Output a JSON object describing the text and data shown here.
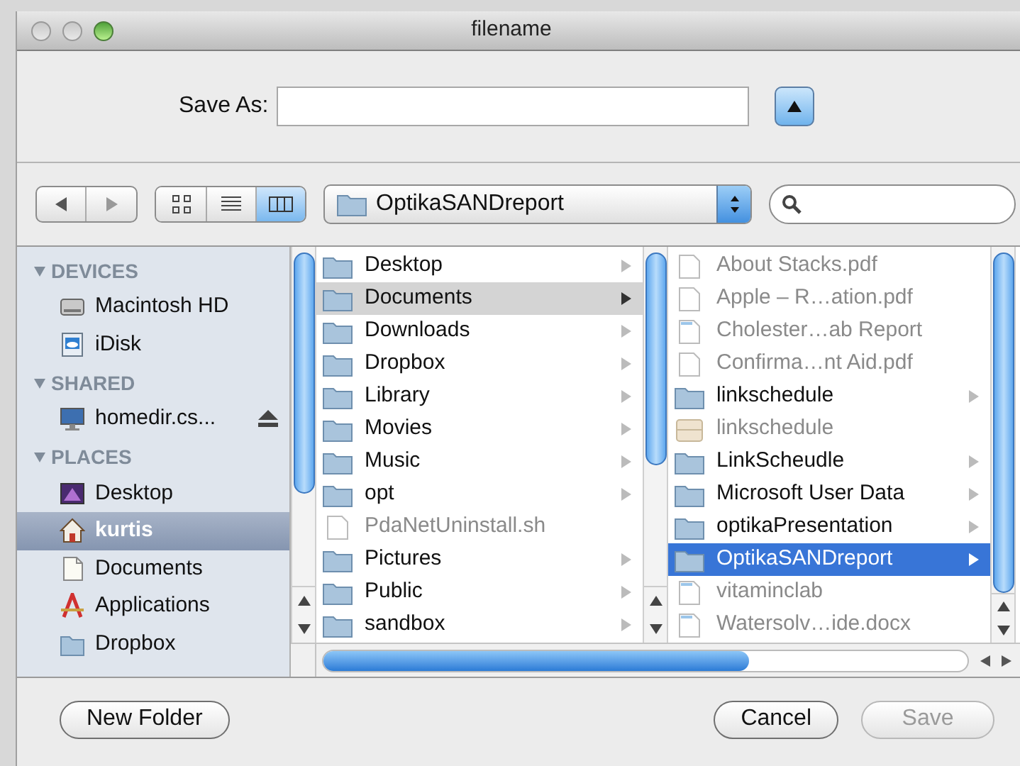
{
  "window": {
    "title": "filename"
  },
  "save_as": {
    "label": "Save As:",
    "expanded": true
  },
  "toolbar": {
    "views": [
      {
        "kind": "icons",
        "selected": false
      },
      {
        "kind": "list",
        "selected": false
      },
      {
        "kind": "columns",
        "selected": true
      }
    ],
    "location": "OptikaSANDreport"
  },
  "sidebar": {
    "sections": [
      {
        "title": "DEVICES",
        "items": [
          {
            "label": "Macintosh HD",
            "kind": "disk",
            "selected": false
          },
          {
            "label": "iDisk",
            "kind": "idisk",
            "selected": false
          }
        ]
      },
      {
        "title": "SHARED",
        "items": [
          {
            "label": "homedir.cs...",
            "kind": "computer",
            "selected": false,
            "eject": true
          }
        ]
      },
      {
        "title": "PLACES",
        "items": [
          {
            "label": "Desktop",
            "kind": "desktop",
            "selected": false
          },
          {
            "label": "kurtis",
            "kind": "home",
            "selected": true
          },
          {
            "label": "Documents",
            "kind": "documents",
            "selected": false
          },
          {
            "label": "Applications",
            "kind": "applications",
            "selected": false
          },
          {
            "label": "Dropbox",
            "kind": "dropbox",
            "selected": false
          }
        ]
      }
    ]
  },
  "columns": [
    {
      "items": [
        {
          "label": "Desktop",
          "kind": "folder",
          "disabled": false,
          "selected": false
        },
        {
          "label": "Documents",
          "kind": "folder",
          "disabled": false,
          "selected": true
        },
        {
          "label": "Downloads",
          "kind": "folder",
          "disabled": false,
          "selected": false
        },
        {
          "label": "Dropbox",
          "kind": "folder",
          "disabled": false,
          "selected": false
        },
        {
          "label": "Library",
          "kind": "folder",
          "disabled": false,
          "selected": false
        },
        {
          "label": "Movies",
          "kind": "folder",
          "disabled": false,
          "selected": false
        },
        {
          "label": "Music",
          "kind": "folder",
          "disabled": false,
          "selected": false
        },
        {
          "label": "opt",
          "kind": "folder",
          "disabled": false,
          "selected": false
        },
        {
          "label": "PdaNetUninstall.sh",
          "kind": "file",
          "disabled": true,
          "selected": false
        },
        {
          "label": "Pictures",
          "kind": "folder",
          "disabled": false,
          "selected": false
        },
        {
          "label": "Public",
          "kind": "folder",
          "disabled": false,
          "selected": false
        },
        {
          "label": "sandbox",
          "kind": "folder",
          "disabled": false,
          "selected": false
        }
      ]
    },
    {
      "items": [
        {
          "label": "About Stacks.pdf",
          "kind": "file",
          "disabled": true,
          "selected": false
        },
        {
          "label": "Apple – R…ation.pdf",
          "kind": "file",
          "disabled": true,
          "selected": false
        },
        {
          "label": "Cholester…ab Report",
          "kind": "text",
          "disabled": true,
          "selected": false
        },
        {
          "label": "Confirma…nt Aid.pdf",
          "kind": "file",
          "disabled": true,
          "selected": false
        },
        {
          "label": "linkschedule",
          "kind": "folder",
          "disabled": false,
          "selected": false
        },
        {
          "label": "linkschedule",
          "kind": "package",
          "disabled": true,
          "selected": false
        },
        {
          "label": "LinkScheudle",
          "kind": "folder",
          "disabled": false,
          "selected": false
        },
        {
          "label": "Microsoft User Data",
          "kind": "folder",
          "disabled": false,
          "selected": false
        },
        {
          "label": "optikaPresentation",
          "kind": "folder",
          "disabled": false,
          "selected": false
        },
        {
          "label": "OptikaSANDreport",
          "kind": "folder",
          "disabled": false,
          "selected": true
        },
        {
          "label": "vitaminclab",
          "kind": "text",
          "disabled": true,
          "selected": false
        },
        {
          "label": "Watersolv…ide.docx",
          "kind": "text",
          "disabled": true,
          "selected": false
        }
      ]
    }
  ],
  "buttons": [
    {
      "label": "New Folder",
      "disabled": false
    },
    {
      "label": "Cancel",
      "disabled": false
    },
    {
      "label": "Save",
      "disabled": true
    }
  ]
}
